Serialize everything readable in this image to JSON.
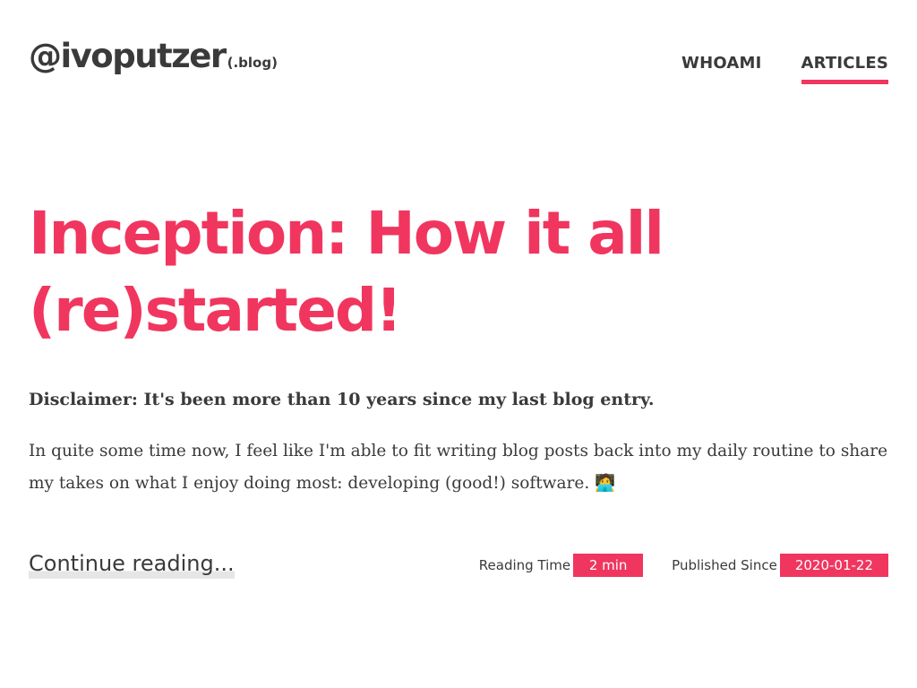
{
  "header": {
    "logo_main": "@ivoputzer",
    "logo_suffix": "(.blog)",
    "nav": [
      {
        "label": "WHOAMI",
        "active": false
      },
      {
        "label": "ARTICLES",
        "active": true
      }
    ]
  },
  "article": {
    "title": "Inception: How it all (re)started!",
    "disclaimer": "Disclaimer: It's been more than 10 years since my last blog entry.",
    "intro": "In quite some time now, I feel like I'm able to fit writing blog posts back into my daily routine to share my takes on what I enjoy doing most: developing (good!) software. 🧑‍💻",
    "continue_label": "Continue reading...",
    "reading_time_label": "Reading Time",
    "reading_time_value": "2 min",
    "published_label": "Published Since",
    "published_value": "2020-01-22"
  },
  "colors": {
    "accent": "#f0365f",
    "text": "#3a3a3a",
    "background": "#ffffff"
  }
}
